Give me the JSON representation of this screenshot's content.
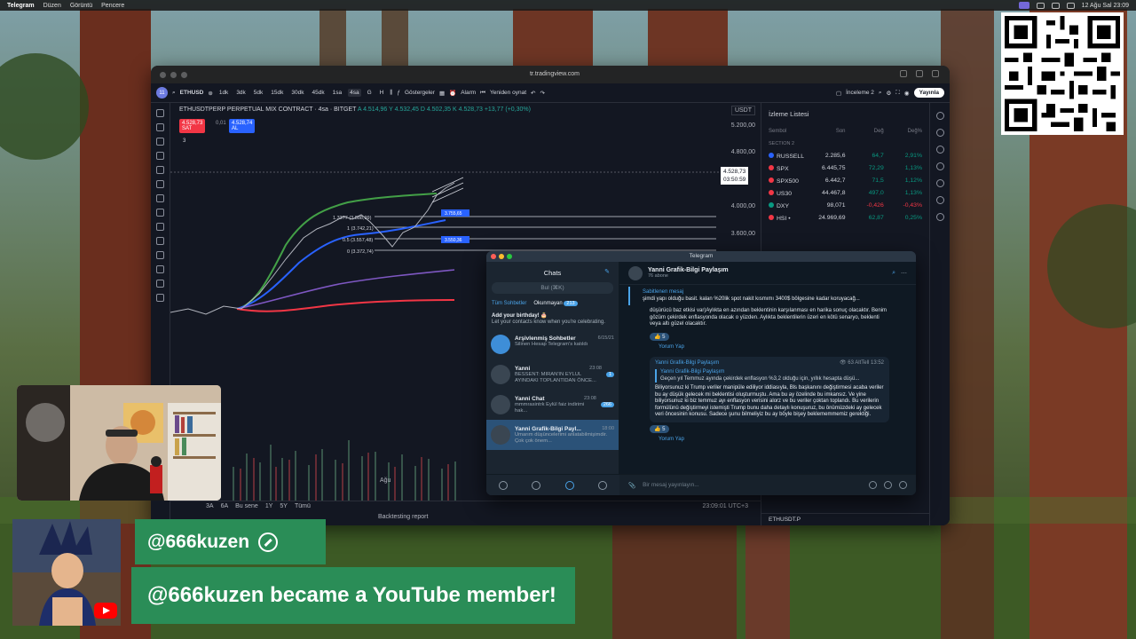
{
  "menubar": {
    "app": "Telegram",
    "items": [
      "Düzen",
      "Görüntü",
      "Pencere"
    ],
    "datetime": "12 Ağu Sal 23:09"
  },
  "browser": {
    "url": "tr.tradingview.com"
  },
  "tv": {
    "avatar_badge": "11",
    "symbol": "ETHUSD",
    "timeframes": [
      "1dk",
      "3dk",
      "5dk",
      "15dk",
      "30dk",
      "45dk",
      "1sa",
      "4sa",
      "G",
      "H"
    ],
    "active_timeframe": "4sa",
    "indicators_label": "Göstergeler",
    "alarm_label": "Alarm",
    "replay_label": "Yeniden oynat",
    "layout_label": "İnceleme 2",
    "publish_label": "Yayınla",
    "legend": {
      "title": "ETHUSDTPERP PERPETUAL MIX CONTRACT · 4sa · BITGET",
      "ohlc": "A 4.514,96  Y 4.532,45  D 4.502,35  K 4.528,73  +13,77 (+0,30%)",
      "sell_price": "4.528,73",
      "sell_label": "SAT",
      "spread": "0,01",
      "buy_price": "4.528,74",
      "buy_label": "AL",
      "indicator_count": "3"
    },
    "currency": "USDT",
    "price_axis": [
      "5.200,00",
      "4.800,00",
      "4.000,00",
      "3.600,00"
    ],
    "current_price": "4.528,73",
    "countdown": "03:50:59",
    "fib_levels": [
      {
        "label": "1.3377 (3.888,99)"
      },
      {
        "label": "1 (3.742,21)"
      },
      {
        "label": "0.5 (3.557,48)"
      },
      {
        "label": "0 (3.372,74)"
      }
    ],
    "tags": [
      "3.755,65",
      "3.550,36"
    ],
    "x_axis_label": "Ağu",
    "ranges": [
      "3A",
      "6A",
      "Bu sene",
      "1Y",
      "5Y",
      "Tümü"
    ],
    "bottom_time": "23:09:01 UTC+3",
    "backtesting": "Backtesting report"
  },
  "watchlist": {
    "title": "İzleme Listesi",
    "cols": [
      "Sembol",
      "Son",
      "Değ",
      "Değ%"
    ],
    "section": "SECTION 2",
    "rows": [
      {
        "sym": "RUSSELL",
        "last": "2.285,6",
        "chg": "64,7",
        "pct": "2,91%",
        "dir": "pos",
        "color": "#2962ff"
      },
      {
        "sym": "SPX",
        "last": "6.445,75",
        "chg": "72,29",
        "pct": "1,13%",
        "dir": "pos",
        "color": "#f23645"
      },
      {
        "sym": "SPX500",
        "last": "6.442,7",
        "chg": "71,5",
        "pct": "1,12%",
        "dir": "pos",
        "color": "#f23645"
      },
      {
        "sym": "US30",
        "last": "44.467,8",
        "chg": "497,0",
        "pct": "1,13%",
        "dir": "pos",
        "color": "#f23645"
      },
      {
        "sym": "DXY",
        "last": "98,071",
        "chg": "-0,426",
        "pct": "-0,43%",
        "dir": "neg",
        "color": "#089981"
      },
      {
        "sym": "HSI •",
        "last": "24.969,69",
        "chg": "62,87",
        "pct": "0,25%",
        "dir": "pos",
        "color": "#f23645"
      }
    ],
    "footer_symbol": "ETHUSDT.P"
  },
  "telegram": {
    "window_title": "Telegram",
    "chats_title": "Chats",
    "search_placeholder": "Bul (⌘K)",
    "tab_all": "Tüm Sohbetler",
    "tab_unread": "Okunmayan",
    "unread_count": "213",
    "birthday_title": "Add your birthday! 🎂",
    "birthday_text": "Let your contacts know when you're celebrating.",
    "chats": [
      {
        "name": "Arşivlenmiş Sohbetler",
        "time": "6/15/21",
        "msg": "Silinen Hesap Telegram's katıldı"
      },
      {
        "name": "Yanni",
        "time": "23:08",
        "msg": "BESSENT: MIRAN'IN EYLÜL AYINDAKI TOPLANTIDAN ÖNCE..."
      },
      {
        "name": "Yanni Chat",
        "time": "23:08",
        "msg": "mmmrasintrk Eylül faiz indirimi hak..."
      },
      {
        "name": "Yanni Grafik-Bilgi Payl...",
        "time": "18:00",
        "msg": "Umarım düşüncelerimi anlatabilmişimdir. Çok çok önem..."
      }
    ],
    "chats_badges": [
      "",
      "1",
      "266",
      ""
    ],
    "channel_name": "Yanni Grafik-Bilgi Paylaşım",
    "channel_sub": "76 abone",
    "pinned_label": "Sabitlenen mesaj",
    "pinned_text": "şimdi yapı olduğu basit. kalan %20lik spot nakit kısmımı 3400$ bölgesine kadar koruyacağ...",
    "msg1": "düşürücü baz etkisi var)Aylıkta en azından beklentinin karşılanması en harika sonuç olacaktır. Benim gözüm çekirdek enflasyonda olacak o yüzden. Aylıkta beklentilerin üzeri en kötü senaryo, beklenti veya altı güzel olacaktır.",
    "react1": "👍 5",
    "comment_label": "Yorum Yap",
    "post_author": "Yanni Grafik-Bilgi Paylaşım",
    "post_meta": "👁 63 AltTell 13:52",
    "quote_author": "Yanni Grafik-Bilgi Paylaşım",
    "quote_text": "Geçen yıl Temmuz ayında çekirdek enflasyon %3,2 olduğu için, yıllık hesapta düşü...",
    "post_text": "Biliyorsunuz ki Trump veriler manipüle ediliyor iddiasıyla, Bls başkanını değiştirmesi acaba veriler bu ay düşük gelecek mi beklentisi oluşturmuştu. Ama bu ay özelinde bu imkansız. Ve yine biliyorsunuz ki biz temmuz ayı enflasyon verisini alorz ve bu veriler çoktan toplandı. Bu verilerin formülünü değiştirmeyi istemişti Trump bunu daha detaylı konuşuruz, bu önümüzdeki ay gelecek veri öncesinin konusu. Sadece şunu bilmeliyiz bu ay böyle bişey beklememmemiz gerektiği.",
    "react2": "👍 5",
    "composer_placeholder": "Bir mesaj yayınlayın...",
    "calls_badge": "4"
  },
  "alert": {
    "username": "@666kuzen",
    "message": "@666kuzen became a YouTube member!"
  }
}
